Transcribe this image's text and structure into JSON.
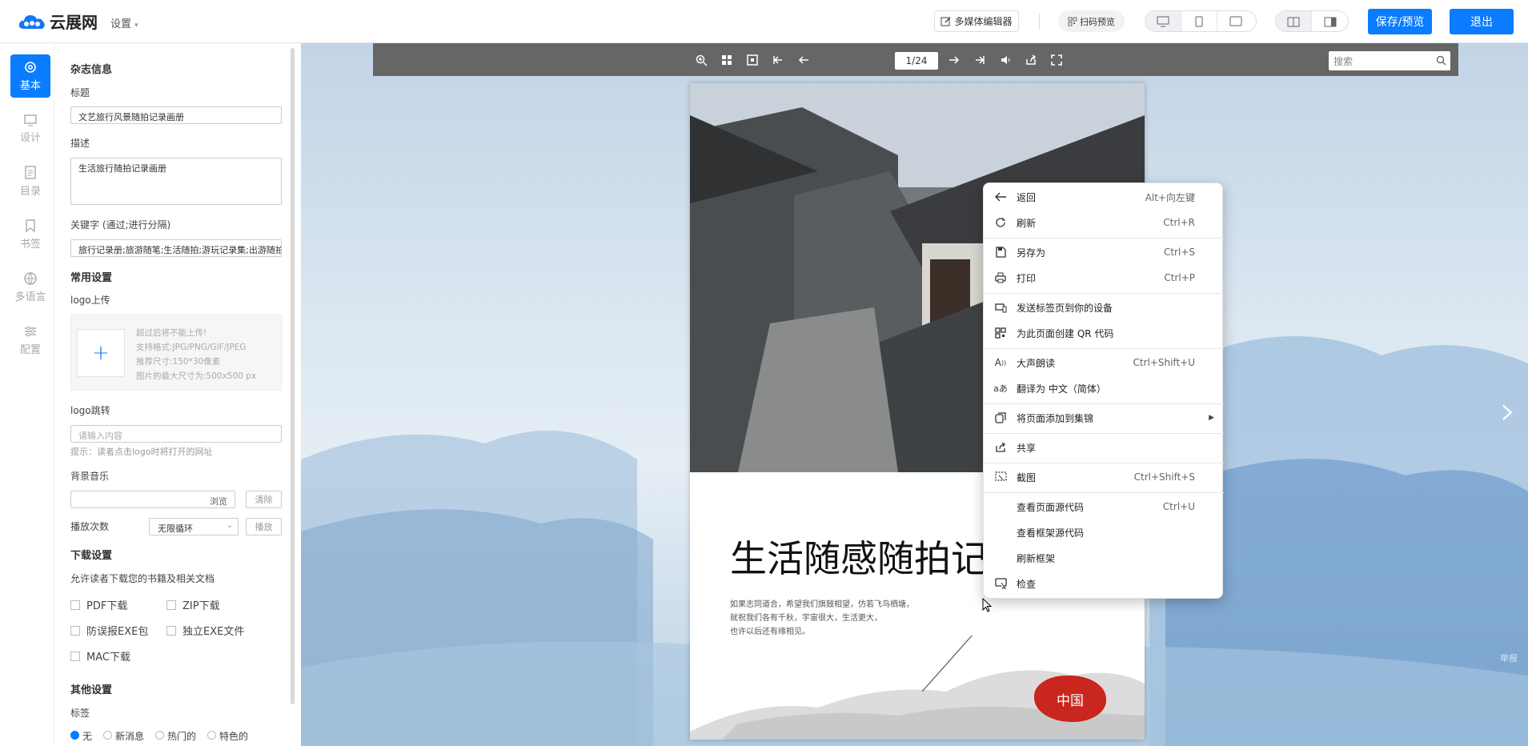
{
  "brand": {
    "name": "云展网"
  },
  "header": {
    "settings_label": "设置",
    "multimedia_editor": "多媒体编辑器",
    "scan_preview": "扫码预览",
    "save_preview": "保存/预览",
    "exit": "退出",
    "view_modes": [
      "desktop-icon",
      "phone-icon",
      "tablet-icon"
    ],
    "layout_modes": [
      "double-page-icon",
      "single-page-icon"
    ]
  },
  "nav": [
    {
      "label": "基本",
      "icon": "gear-icon",
      "active": true
    },
    {
      "label": "设计",
      "icon": "monitor-icon"
    },
    {
      "label": "目录",
      "icon": "document-icon"
    },
    {
      "label": "书签",
      "icon": "bookmark-icon"
    },
    {
      "label": "多语言",
      "icon": "globe-icon"
    },
    {
      "label": "配置",
      "icon": "sliders-icon"
    }
  ],
  "panel": {
    "magazine_info": "杂志信息",
    "title_label": "标题",
    "title_value": "文艺旅行风景随拍记录画册",
    "desc_label": "描述",
    "desc_value": "生活旅行随拍记录画册",
    "keywords_label": "关键字 (通过;进行分隔)",
    "keywords_value": "旅行记录册;旅游随笔;生活随拍;游玩记录集;出游随拍",
    "common_settings": "常用设置",
    "logo_upload_label": "logo上传",
    "logo_hints": [
      "超过后将不能上传!",
      "支持格式:JPG/PNG/GIF/JPEG",
      "推荐尺寸:150*30像素",
      "图片的最大尺寸为:500x500 px"
    ],
    "logo_link_label": "logo跳转",
    "logo_link_placeholder": "请输入内容",
    "logo_link_hint": "提示：读者点击logo时将打开的网址",
    "bgm_label": "背景音乐",
    "browse": "浏览",
    "clear": "清除",
    "play_count_label": "播放次数",
    "play_count_value": "无限循环",
    "play": "播放",
    "download_settings": "下载设置",
    "download_desc": "允许读者下载您的书籍及相关文档",
    "downloads": [
      "PDF下载",
      "ZIP下载",
      "防误报EXE包",
      "独立EXE文件",
      "MAC下载"
    ],
    "other_settings": "其他设置",
    "tags_label": "标签",
    "tags": [
      "无",
      "新消息",
      "热门的",
      "特色的"
    ]
  },
  "viewer": {
    "page_indicator": "1/24",
    "search_placeholder": "搜索",
    "report": "举报"
  },
  "cover": {
    "title": "生活随感随拍记",
    "lines": [
      "如果志同道合，希望我们旗鼓相望，仿若飞鸟栖塘，",
      "就祝我们各有千秋，宇宙很大，生活更大，",
      "也许以后还有缘相见。"
    ],
    "seal": "中国",
    "seal_color": "#c8261e"
  },
  "context_menu": [
    {
      "label": "返回",
      "shortcut": "Alt+向左键",
      "icon": "back-arrow-icon"
    },
    {
      "label": "刷新",
      "shortcut": "Ctrl+R",
      "icon": "refresh-icon"
    },
    {
      "label": "另存为",
      "shortcut": "Ctrl+S",
      "icon": "save-as-icon"
    },
    {
      "label": "打印",
      "shortcut": "Ctrl+P",
      "icon": "print-icon"
    },
    {
      "label": "发送标签页到你的设备",
      "shortcut": "",
      "icon": "send-device-icon"
    },
    {
      "label": "为此页面创建 QR 代码",
      "shortcut": "",
      "icon": "qr-code-icon"
    },
    {
      "label": "大声朗读",
      "shortcut": "Ctrl+Shift+U",
      "icon": "read-aloud-icon"
    },
    {
      "label": "翻译为 中文（简体）",
      "shortcut": "",
      "icon": "translate-icon"
    },
    {
      "label": "将页面添加到集锦",
      "shortcut": "",
      "icon": "collections-icon"
    },
    {
      "label": "共享",
      "shortcut": "",
      "icon": "share-icon"
    },
    {
      "label": "截图",
      "shortcut": "Ctrl+Shift+S",
      "icon": "screenshot-icon"
    },
    {
      "label": "查看页面源代码",
      "shortcut": "Ctrl+U",
      "icon": ""
    },
    {
      "label": "查看框架源代码",
      "shortcut": "",
      "icon": ""
    },
    {
      "label": "刷新框架",
      "shortcut": "",
      "icon": ""
    },
    {
      "label": "检查",
      "shortcut": "",
      "icon": "inspect-icon"
    }
  ],
  "colors": {
    "accent": "#0a7cff",
    "toolbar": "#666666",
    "seal": "#c8261e"
  }
}
